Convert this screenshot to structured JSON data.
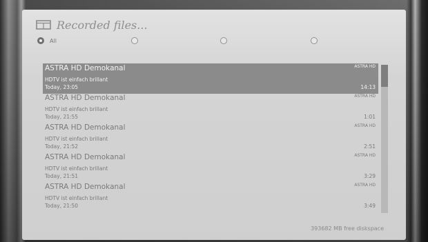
{
  "header": {
    "icon": "film-icon",
    "title": "Recorded files..."
  },
  "filters": [
    {
      "label": "All",
      "selected": true
    },
    {
      "label": "",
      "selected": false
    },
    {
      "label": "",
      "selected": false
    },
    {
      "label": "",
      "selected": false
    }
  ],
  "recordings": [
    {
      "channel": "ASTRA HD Demokanal",
      "channel_logo": "ASTRA HD",
      "title": "HDTV ist einfach brillant",
      "date": "Today, 23:05",
      "duration": "14:13",
      "selected": true
    },
    {
      "channel": "ASTRA HD Demokanal",
      "channel_logo": "ASTRA HD",
      "title": "HDTV ist einfach brillant",
      "date": "Today, 21:55",
      "duration": "1:01",
      "selected": false
    },
    {
      "channel": "ASTRA HD Demokanal",
      "channel_logo": "ASTRA HD",
      "title": "HDTV ist einfach brillant",
      "date": "Today, 21:52",
      "duration": "2:51",
      "selected": false
    },
    {
      "channel": "ASTRA HD Demokanal",
      "channel_logo": "ASTRA HD",
      "title": "HDTV ist einfach brillant",
      "date": "Today, 21:51",
      "duration": "3:29",
      "selected": false
    },
    {
      "channel": "ASTRA HD Demokanal",
      "channel_logo": "ASTRA HD",
      "title": "HDTV ist einfach brillant",
      "date": "Today, 21:50",
      "duration": "3:49",
      "selected": false
    }
  ],
  "footer": {
    "free_space": "393682 MB free diskspace"
  },
  "colors": {
    "selected_row": "#8b8b8b",
    "panel": "#d4d4d4"
  }
}
